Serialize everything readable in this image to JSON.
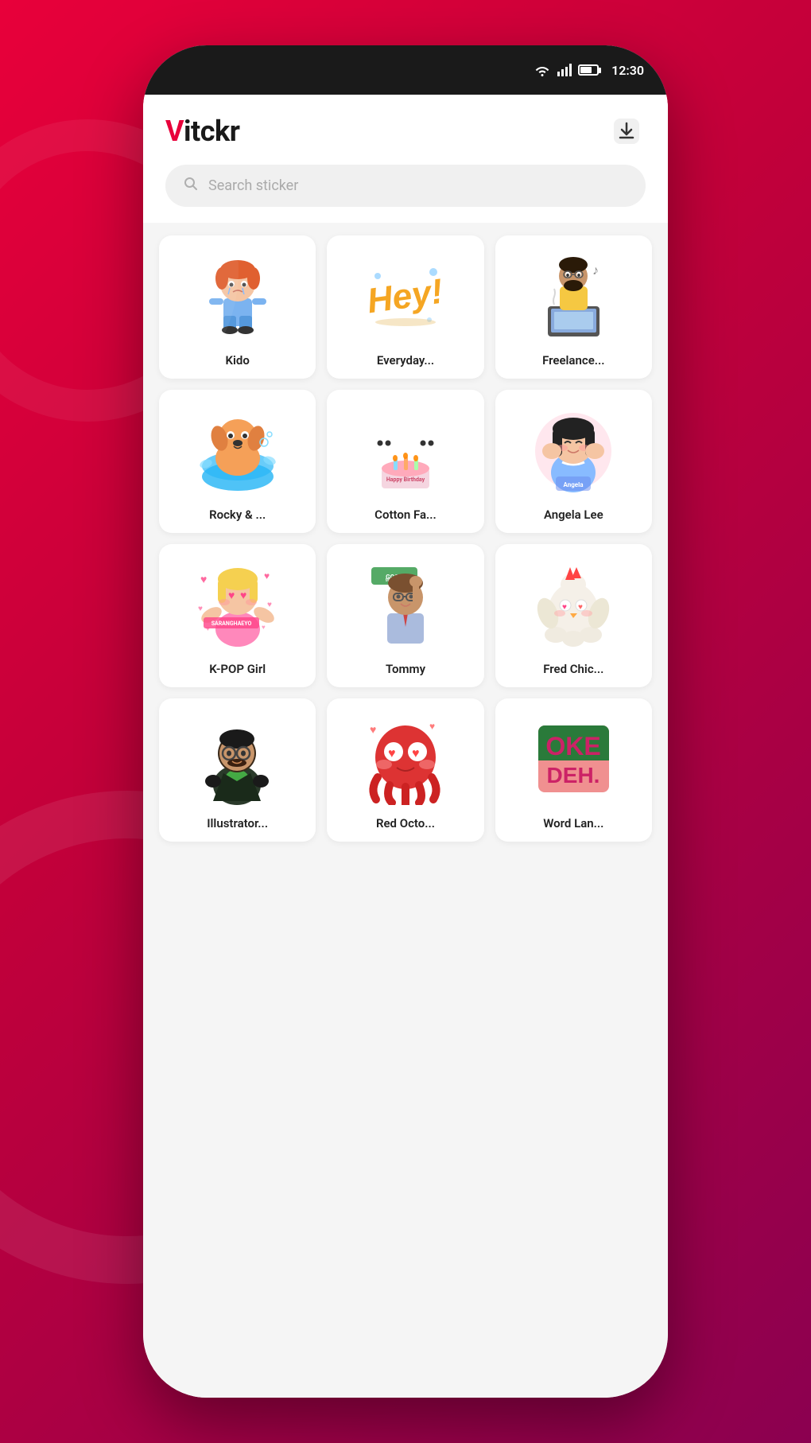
{
  "statusBar": {
    "time": "12:30"
  },
  "header": {
    "logoPrefix": "V",
    "logoSuffix": "itckr"
  },
  "search": {
    "placeholder": "Search sticker"
  },
  "stickers": [
    {
      "id": "kido",
      "label": "Kido",
      "color": "#ff9966",
      "emoji": "😢",
      "bg": "#fff0e8"
    },
    {
      "id": "everyday",
      "label": "Everyday...",
      "color": "#f5a623",
      "emoji": "👋",
      "bg": "#fff9e8"
    },
    {
      "id": "freelance",
      "label": "Freelance...",
      "color": "#f5c842",
      "emoji": "💻",
      "bg": "#fffce8"
    },
    {
      "id": "rocky",
      "label": "Rocky & ...",
      "color": "#ffaa44",
      "emoji": "🐶",
      "bg": "#fff5e0"
    },
    {
      "id": "cotton",
      "label": "Cotton Fa...",
      "color": "#88ddff",
      "emoji": "🐱",
      "bg": "#e8f8ff"
    },
    {
      "id": "angela",
      "label": "Angela Lee",
      "color": "#ff88bb",
      "emoji": "🙈",
      "bg": "#ffe8f2"
    },
    {
      "id": "kpop",
      "label": "K-POP Girl",
      "color": "#ff4488",
      "emoji": "💕",
      "bg": "#ffe8f0"
    },
    {
      "id": "tommy",
      "label": "Tommy",
      "color": "#88aa66",
      "emoji": "😎",
      "bg": "#f0f5e8"
    },
    {
      "id": "fred",
      "label": "Fred Chic...",
      "color": "#ffccaa",
      "emoji": "🐔",
      "bg": "#fff8f0"
    },
    {
      "id": "illustrator",
      "label": "Illustrator...",
      "color": "#447755",
      "emoji": "🎨",
      "bg": "#e8f5ee"
    },
    {
      "id": "redocto",
      "label": "Red Octo...",
      "color": "#ff4444",
      "emoji": "🐙",
      "bg": "#ffe8e8"
    },
    {
      "id": "wordlan",
      "label": "Word Lan...",
      "color": "#cc4488",
      "emoji": "💬",
      "bg": "#ffe8f5"
    }
  ],
  "stickerVisuals": {
    "kido": {
      "svgDesc": "crying boy character"
    },
    "everyday": {
      "text": "Hey!",
      "style": "yellow italic bold"
    },
    "freelance": {
      "svgDesc": "man at laptop"
    },
    "rocky": {
      "svgDesc": "dog in tub"
    },
    "cotton": {
      "svgDesc": "birthday cats"
    },
    "angela": {
      "svgDesc": "shy girl"
    },
    "kpop": {
      "svgDesc": "kpop girl with hearts"
    },
    "tommy": {
      "svgDesc": "man good morning"
    },
    "fred": {
      "svgDesc": "chicken character"
    },
    "illustrator": {
      "svgDesc": "man with glasses"
    },
    "redocto": {
      "svgDesc": "red octopus"
    },
    "wordlan": {
      "text": "OKE DEH.",
      "style": "green on pink"
    }
  }
}
